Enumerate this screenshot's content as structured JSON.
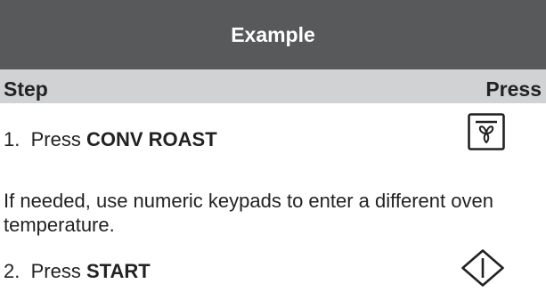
{
  "title": "Example",
  "header": {
    "step": "Step",
    "press": "Press"
  },
  "steps": [
    {
      "number": "1.",
      "prefix": "Press",
      "key": "CONV ROAST",
      "icon": "conv-roast-key-icon"
    },
    {
      "number": "2.",
      "prefix": "Press",
      "key": "START",
      "icon": "start-key-icon"
    }
  ],
  "note": "If needed, use numeric keypads to enter a different oven temperature.",
  "colors": {
    "title_bg": "#58595b",
    "header_bg": "#d1d2d4",
    "text": "#222222"
  }
}
